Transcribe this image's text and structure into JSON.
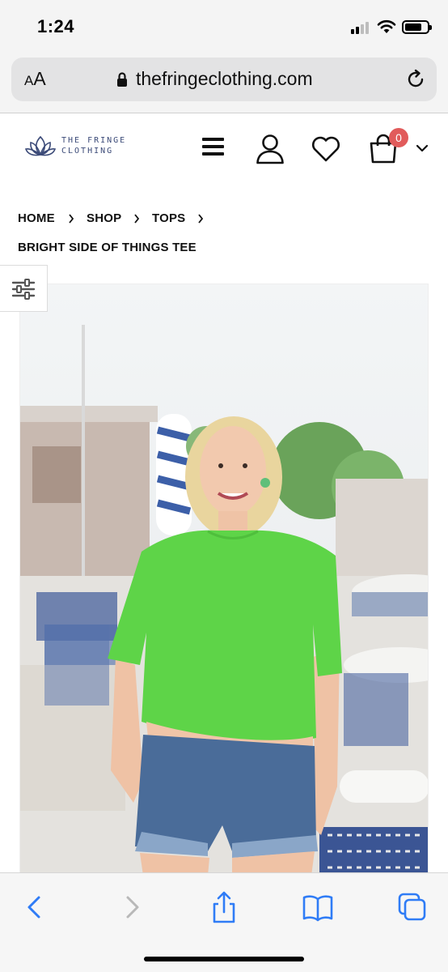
{
  "status_bar": {
    "time": "1:24"
  },
  "browser": {
    "text_size_small": "A",
    "text_size_large": "A",
    "url": "thefringeclothing.com"
  },
  "site": {
    "logo_line1": "THE FRINGE",
    "logo_line2": "CLOTHING",
    "cart_count": "0",
    "brand_color": "#3b4a78",
    "badge_color": "#e15b5b"
  },
  "breadcrumb": {
    "items": [
      "HOME",
      "SHOP",
      "TOPS"
    ],
    "current": "BRIGHT SIDE OF THINGS TEE"
  },
  "product": {
    "image_alt": "Woman wearing bright green cropped tee and denim shorts outdoors",
    "tee_color": "#5ed448"
  },
  "toolbar": {
    "icons": [
      "back-icon",
      "forward-icon",
      "share-icon",
      "bookmarks-icon",
      "tabs-icon"
    ]
  }
}
